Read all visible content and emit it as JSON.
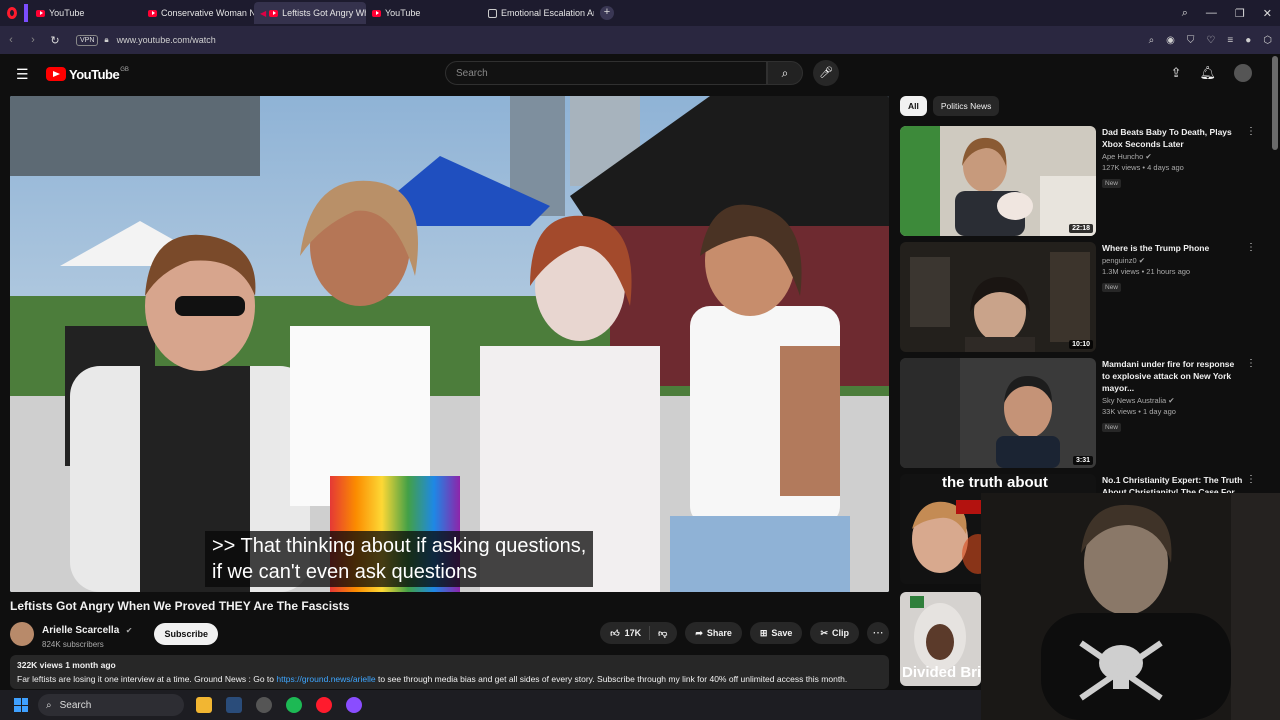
{
  "browser": {
    "tabs": [
      {
        "label": "YouTube",
        "active": false,
        "icon": "youtube-favicon"
      },
      {
        "label": "Conservative Woman NOT",
        "active": false,
        "icon": "youtube-favicon"
      },
      {
        "label": "Leftists Got Angry Wh",
        "active": true,
        "icon": "youtube-favicon"
      },
      {
        "label": "YouTube",
        "active": false,
        "icon": "youtube-favicon"
      },
      {
        "label": "Emotional Escalation Anal",
        "active": false,
        "icon": "generic-favicon"
      }
    ],
    "new_tab": "+",
    "vpn_badge": "VPN",
    "url": "www.youtube.com/watch"
  },
  "youtube": {
    "logo_text": "YouTube",
    "logo_country": "GB",
    "search_placeholder": "Search"
  },
  "video": {
    "caption_line1": ">> That thinking about if asking questions,",
    "caption_line2": "if we can't even ask questions",
    "title": "Leftists Got Angry When We Proved THEY Are The Fascists",
    "channel": "Arielle Scarcella",
    "subscribers": "824K subscribers",
    "subscribe_label": "Subscribe",
    "likes": "17K",
    "share_label": "Share",
    "save_label": "Save",
    "clip_label": "Clip",
    "views_line": "322K views  1 month ago",
    "desc_prefix": "Far leftists are losing it one interview at a time. Ground News : Go to ",
    "desc_link": "https://ground.news/arielle",
    "desc_suffix": " to see through media bias and get all sides of every story. Subscribe through my link for 40% off unlimited access this month."
  },
  "chips": [
    {
      "label": "All",
      "active": true
    },
    {
      "label": "Politics News",
      "active": false
    }
  ],
  "recommendations": [
    {
      "title": "Dad Beats Baby To Death, Plays Xbox Seconds Later",
      "channel": "Ape Huncho",
      "stats": "127K views • 4 days ago",
      "badge": "New",
      "duration": "22:18"
    },
    {
      "title": "Where is the Trump Phone",
      "channel": "penguinz0",
      "stats": "1.3M views • 21 hours ago",
      "badge": "New",
      "duration": "10:10"
    },
    {
      "title": "Mamdani under fire for response to explosive attack on New York mayor...",
      "channel": "Sky News Australia",
      "stats": "33K views • 1 day ago",
      "badge": "New",
      "duration": "3:31"
    },
    {
      "title": "No.1 Christianity Expert: The Truth About Christianity! The Case For ...",
      "channel": "",
      "stats": "",
      "badge": "",
      "duration": "",
      "thumb_text": "the truth about"
    },
    {
      "title": "",
      "channel": "",
      "stats": "",
      "badge": "",
      "duration": "",
      "thumb_text": "Divided Bri"
    }
  ],
  "taskbar": {
    "search_label": "Search"
  },
  "colors": {
    "background": "#0f0f0f",
    "youtube_red": "#ff0000",
    "link": "#3ea6ff",
    "opera_red": "#ff1b2d"
  }
}
